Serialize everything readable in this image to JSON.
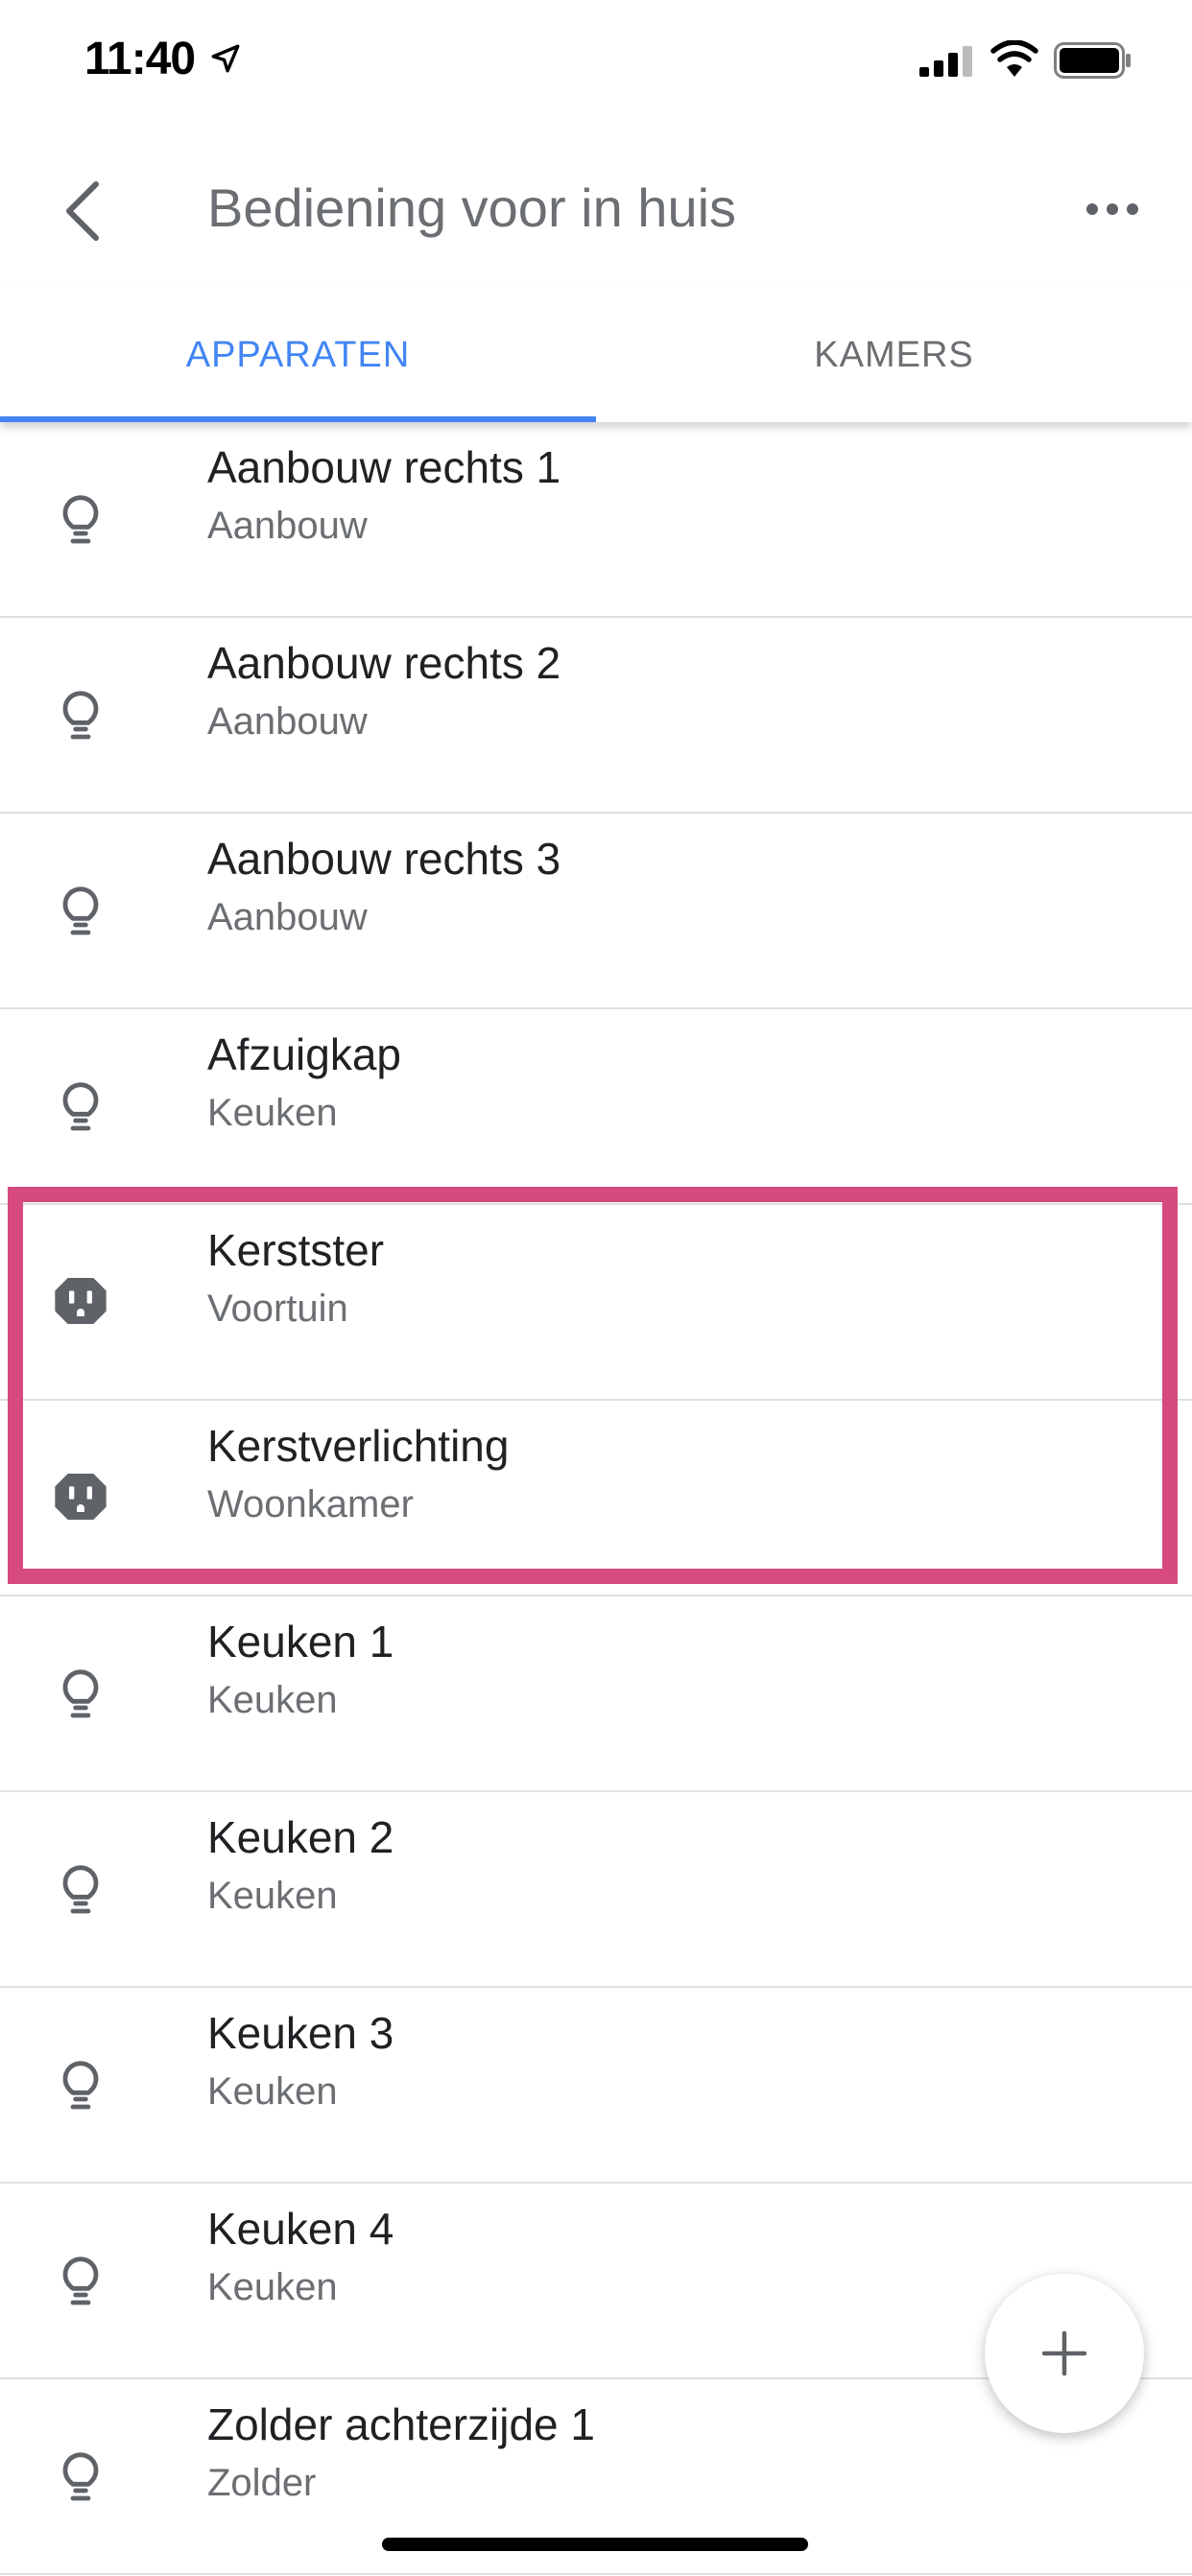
{
  "status_bar": {
    "time": "11:40"
  },
  "header": {
    "title": "Bediening voor in huis"
  },
  "tabs": [
    {
      "label": "APPARATEN",
      "active": true
    },
    {
      "label": "KAMERS",
      "active": false
    }
  ],
  "devices": [
    {
      "name": "Aanbouw rechts 1",
      "room": "Aanbouw",
      "icon": "lightbulb-icon"
    },
    {
      "name": "Aanbouw rechts 2",
      "room": "Aanbouw",
      "icon": "lightbulb-icon"
    },
    {
      "name": "Aanbouw rechts 3",
      "room": "Aanbouw",
      "icon": "lightbulb-icon"
    },
    {
      "name": "Afzuigkap",
      "room": "Keuken",
      "icon": "lightbulb-icon"
    },
    {
      "name": "Kerstster",
      "room": "Voortuin",
      "icon": "power-outlet-icon"
    },
    {
      "name": "Kerstverlichting",
      "room": "Woonkamer",
      "icon": "power-outlet-icon"
    },
    {
      "name": "Keuken 1",
      "room": "Keuken",
      "icon": "lightbulb-icon"
    },
    {
      "name": "Keuken 2",
      "room": "Keuken",
      "icon": "lightbulb-icon"
    },
    {
      "name": "Keuken 3",
      "room": "Keuken",
      "icon": "lightbulb-icon"
    },
    {
      "name": "Keuken 4",
      "room": "Keuken",
      "icon": "lightbulb-icon"
    },
    {
      "name": "Zolder achterzijde 1",
      "room": "Zolder",
      "icon": "lightbulb-icon"
    }
  ],
  "colors": {
    "accent": "#4285f4",
    "highlight": "#d64a7e",
    "icon": "#5f6368",
    "secondary_text": "#6b6e72"
  }
}
